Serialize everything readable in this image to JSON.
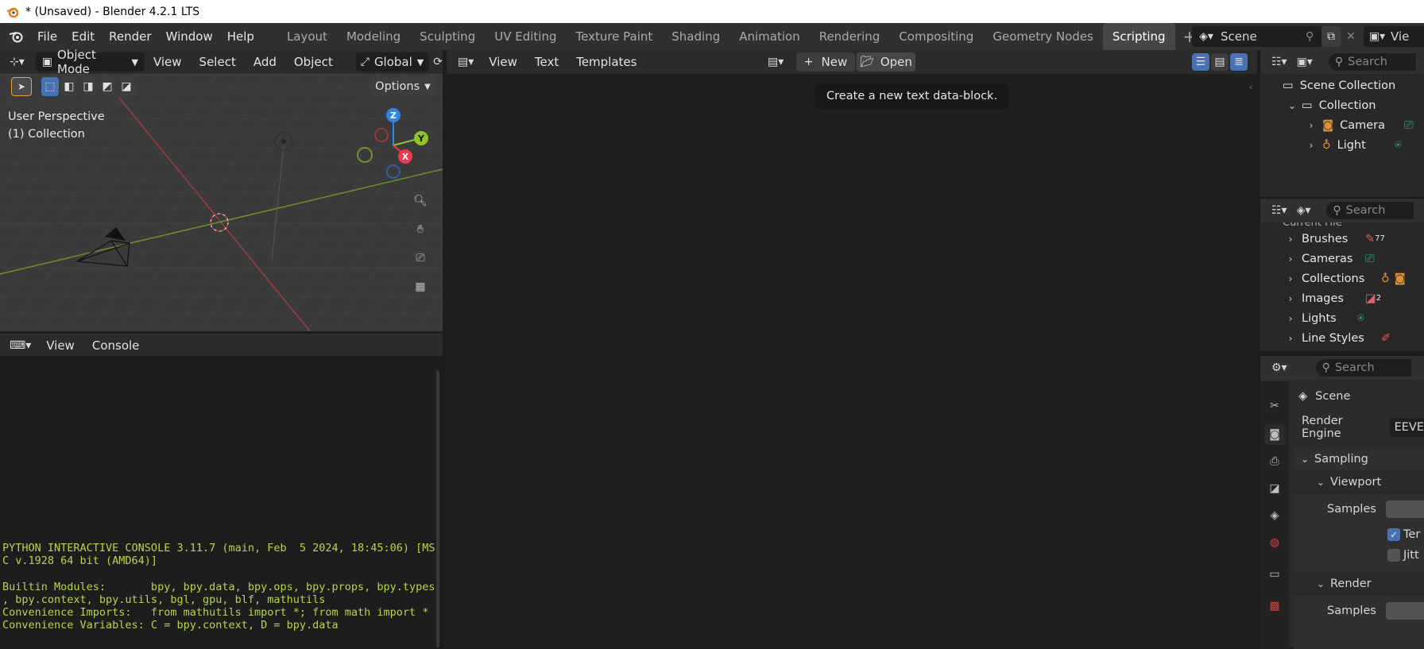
{
  "window": {
    "title": "* (Unsaved) - Blender 4.2.1 LTS"
  },
  "menu": [
    "File",
    "Edit",
    "Render",
    "Window",
    "Help"
  ],
  "workspaces": [
    "Layout",
    "Modeling",
    "Sculpting",
    "UV Editing",
    "Texture Paint",
    "Shading",
    "Animation",
    "Rendering",
    "Compositing",
    "Geometry Nodes",
    "Scripting"
  ],
  "active_workspace": "Scripting",
  "scene": {
    "name": "Scene",
    "view_layer_label": "Vie"
  },
  "viewport": {
    "mode": "Object Mode",
    "menus": [
      "View",
      "Select",
      "Add",
      "Object"
    ],
    "transform": "Global",
    "options": "Options",
    "perspective": "User Perspective",
    "collection": "(1) Collection",
    "gizmo": {
      "x": "X",
      "y": "Y",
      "z": "Z"
    }
  },
  "console": {
    "menus": [
      "View",
      "Console"
    ],
    "lines": [
      "PYTHON INTERACTIVE CONSOLE 3.11.7 (main, Feb  5 2024, 18:45:06) [MS",
      "C v.1928 64 bit (AMD64)]",
      "",
      "Builtin Modules:       bpy, bpy.data, bpy.ops, bpy.props, bpy.types",
      ", bpy.context, bpy.utils, bgl, gpu, blf, mathutils",
      "Convenience Imports:   from mathutils import *; from math import *",
      "Convenience Variables: C = bpy.context, D = bpy.data"
    ]
  },
  "text_editor": {
    "menus": [
      "View",
      "Text",
      "Templates"
    ],
    "new_label": "New",
    "open_label": "Open",
    "tooltip": "Create a new text data-block."
  },
  "outliner": {
    "search_placeholder": "Search",
    "scene_collection": "Scene Collection",
    "collection": "Collection",
    "items": [
      "Camera",
      "Light"
    ]
  },
  "blend_file": {
    "search_placeholder": "Search",
    "header_partial": "Current File",
    "items": [
      {
        "label": "Brushes",
        "count": "77"
      },
      {
        "label": "Cameras",
        "count": ""
      },
      {
        "label": "Collections",
        "count": ""
      },
      {
        "label": "Images",
        "count": "2"
      },
      {
        "label": "Lights",
        "count": ""
      },
      {
        "label": "Line Styles",
        "count": ""
      }
    ]
  },
  "properties": {
    "search_placeholder": "Search",
    "context": "Scene",
    "render_engine_label": "Render Engine",
    "render_engine_value": "EEVE",
    "sampling": "Sampling",
    "viewport": "Viewport",
    "samples": "Samples",
    "temporal": "Ter",
    "jitter": "Jitt",
    "render": "Render",
    "render_samples": "Samples"
  },
  "colors": {
    "accent": "#4772b3",
    "console_text": "#b5d64a",
    "axis_x": "#f0384f",
    "axis_y": "#8ec326",
    "axis_z": "#2f85e3",
    "camera_icon": "#e0923b",
    "light_icon": "#2ab58c"
  }
}
